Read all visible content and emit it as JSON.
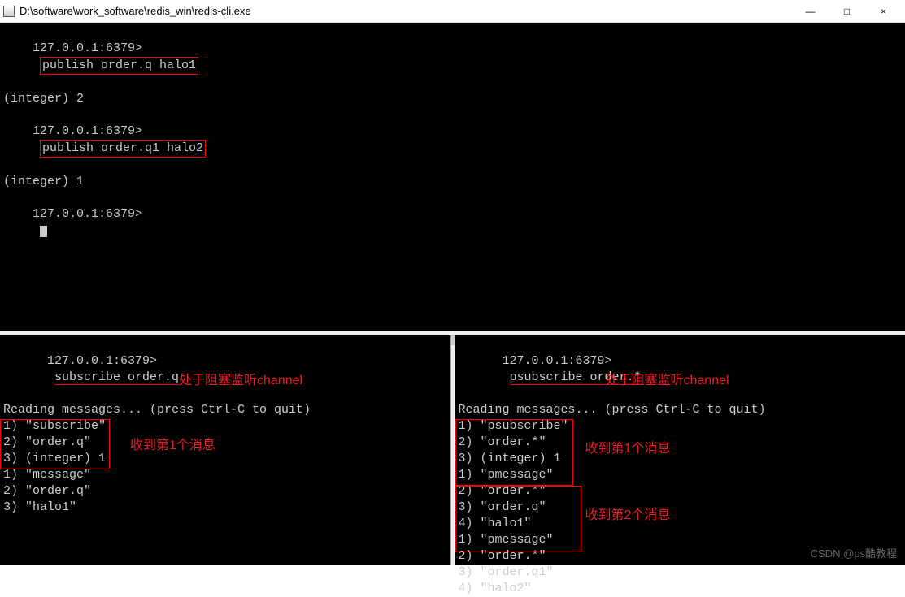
{
  "window": {
    "title": "D:\\software\\work_software\\redis_win\\redis-cli.exe",
    "minimize": "—",
    "maximize": "□",
    "close": "×"
  },
  "top": {
    "prompt": "127.0.0.1:6379>",
    "cmd1": "publish order.q halo1",
    "res1": "(integer) 2",
    "cmd2": "publish order.q1 halo2",
    "res2": "(integer) 1"
  },
  "left": {
    "prompt": "127.0.0.1:6379>",
    "cmd": "subscribe order.q",
    "reading": "Reading messages... (press Ctrl-C to quit)",
    "l1": "1) \"subscribe\"",
    "l2": "2) \"order.q\"",
    "l3": "3) (integer) 1",
    "m1": "1) \"message\"",
    "m2": "2) \"order.q\"",
    "m3": "3) \"halo1\"",
    "annot_block": "处于阻塞监听channel",
    "annot_msg1": "收到第1个消息"
  },
  "right": {
    "prompt": "127.0.0.1:6379>",
    "cmd": "psubscribe order.*",
    "reading": "Reading messages... (press Ctrl-C to quit)",
    "l1": "1) \"psubscribe\"",
    "l2": "2) \"order.*\"",
    "l3": "3) (integer) 1",
    "m1": "1) \"pmessage\"",
    "m2": "2) \"order.*\"",
    "m3": "3) \"order.q\"",
    "m4": "4) \"halo1\"",
    "n1": "1) \"pmessage\"",
    "n2": "2) \"order.*\"",
    "n3": "3) \"order.q1\"",
    "n4": "4) \"halo2\"",
    "annot_block": "处于阻塞监听channel",
    "annot_msg1": "收到第1个消息",
    "annot_msg2": "收到第2个消息"
  },
  "watermark": "CSDN @ps酷教程"
}
